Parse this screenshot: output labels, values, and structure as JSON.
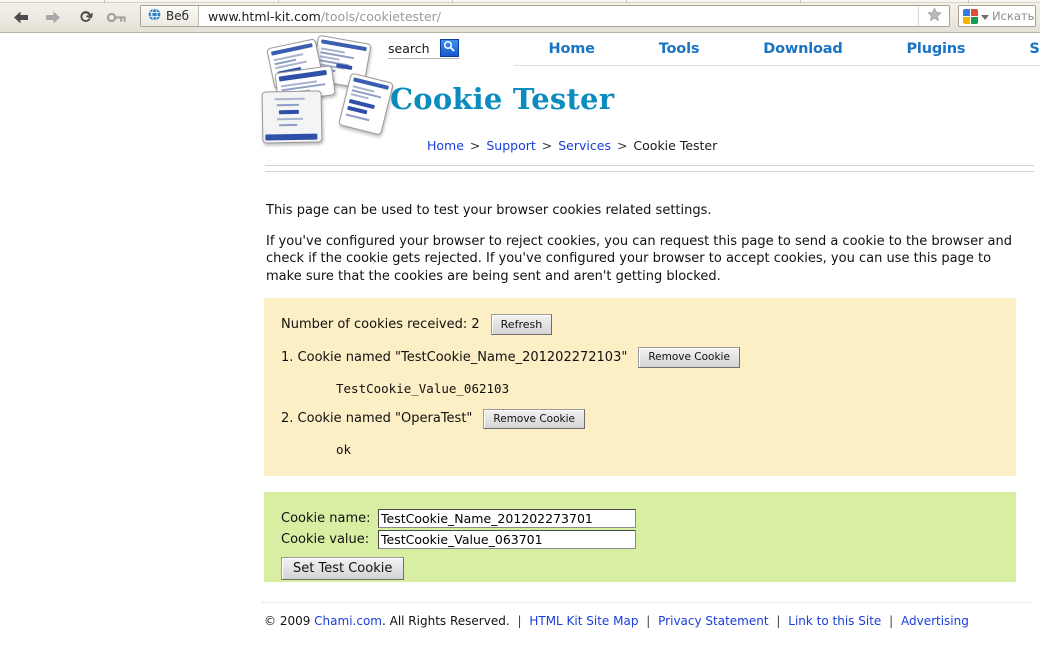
{
  "browser": {
    "back_icon": "back-arrow-icon",
    "forward_icon": "forward-arrow-icon",
    "reload_icon": "reload-icon",
    "key_icon": "key-icon",
    "site_chip_label": "Веб",
    "url_prefix": "www.html-kit.com",
    "url_suffix": "/tools/cookietester/",
    "url_full": "www.html-kit.com/tools/cookietester/",
    "star_icon": "star-bookmark-icon",
    "search_engine_icon": "google-logo-icon",
    "search_dropdown_icon": "chevron-down-icon",
    "search_placeholder": "Искать"
  },
  "header": {
    "logo_alt": "html-kit-screenshots-collage-logo",
    "search": {
      "value": "search",
      "placeholder": "search",
      "button_icon": "magnifier-icon"
    },
    "nav": [
      {
        "label": "Home"
      },
      {
        "label": "Tools"
      },
      {
        "label": "Download"
      },
      {
        "label": "Plugins"
      },
      {
        "label": "Support"
      }
    ],
    "title": "Cookie Tester",
    "title_color": "#0b8cbf",
    "breadcrumb": [
      {
        "label": "Home",
        "link": true
      },
      {
        "label": "Support",
        "link": true
      },
      {
        "label": "Services",
        "link": true
      },
      {
        "label": "Cookie Tester",
        "link": false
      }
    ],
    "breadcrumb_separator": ">"
  },
  "intro": {
    "paragraph1": "This page can be used to test your browser cookies related settings.",
    "paragraph2": "If you've configured your browser to reject cookies, you can request this page to send a cookie to the browser and check if the cookie gets rejected. If you've configured your browser to accept cookies, you can use this page to make sure that the cookies are being sent and aren't getting blocked."
  },
  "cookie_box": {
    "background": "#fceec5",
    "count_label": "Number of cookies received: 2",
    "refresh_label": "Refresh",
    "cookies": [
      {
        "line": "1. Cookie named \"TestCookie_Name_201202272103\"",
        "remove_label": "Remove Cookie",
        "value": "TestCookie_Value_062103"
      },
      {
        "line": "2. Cookie named \"OperaTest\"",
        "remove_label": "Remove Cookie",
        "value": "ok"
      }
    ]
  },
  "form_box": {
    "background": "#d8efa3",
    "name_label": "Cookie name:",
    "name_value": "TestCookie_Name_201202273701",
    "value_label": "Cookie value:",
    "value_value": "TestCookie_Value_063701",
    "submit_label": "Set Test Cookie"
  },
  "footer": {
    "copyright_prefix": "© 2009 ",
    "company": "Chami.com",
    "copyright_suffix": ". All Rights Reserved.",
    "separator": "|",
    "links": [
      {
        "label": "HTML Kit Site Map"
      },
      {
        "label": "Privacy Statement"
      },
      {
        "label": "Link to this Site"
      },
      {
        "label": "Advertising"
      }
    ]
  }
}
